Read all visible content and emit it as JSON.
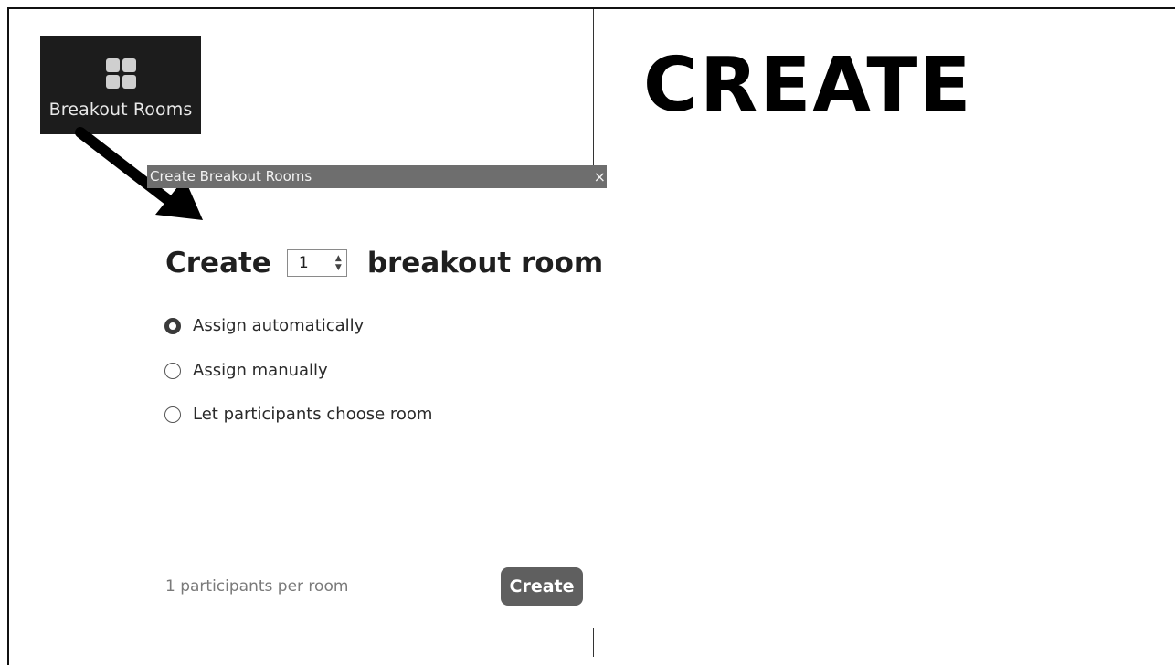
{
  "slide": {
    "title": "CREATE"
  },
  "toolbar": {
    "button_label": "Breakout Rooms",
    "button_icon": "grid-icon"
  },
  "dialog": {
    "title": "Create Breakout Rooms",
    "close_glyph": "×",
    "create_prefix": "Create",
    "room_count": "1",
    "create_suffix": "breakout room",
    "options": [
      {
        "label": "Assign automatically",
        "checked": true
      },
      {
        "label": "Assign manually",
        "checked": false
      },
      {
        "label": "Let participants choose room",
        "checked": false
      }
    ],
    "participants_text": "1 participants per room",
    "create_button": "Create"
  },
  "colors": {
    "toolbar_bg": "#1c1c1c",
    "titlebar_bg": "#6e6e6e",
    "create_button_bg": "#5f5f5f"
  }
}
